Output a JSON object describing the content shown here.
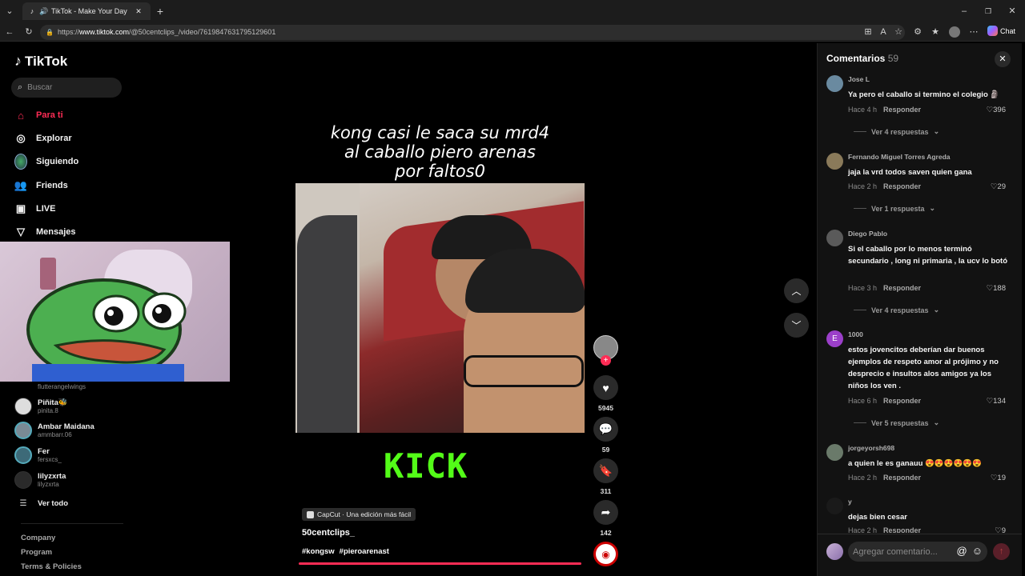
{
  "browser": {
    "tab_title": "TikTok - Make Your Day",
    "url_prefix": "https://",
    "url_host": "www.tiktok.com",
    "url_path": "/@50centclips_/video/7619847631795129601",
    "chat_label": "Chat"
  },
  "sidebar": {
    "logo": "TikTok",
    "search_placeholder": "Buscar",
    "nav": [
      {
        "label": "Para ti",
        "icon": "home-icon"
      },
      {
        "label": "Explorar",
        "icon": "compass-icon"
      },
      {
        "label": "Siguiendo",
        "icon": "following-avatar-icon"
      },
      {
        "label": "Friends",
        "icon": "friends-icon"
      },
      {
        "label": "LIVE",
        "icon": "live-icon"
      },
      {
        "label": "Mensajes",
        "icon": "send-icon"
      }
    ],
    "accounts": [
      {
        "name": "",
        "handle": "flutterangelwings"
      },
      {
        "name": "Piñita🐝",
        "handle": "pinita.8"
      },
      {
        "name": "Ambar Maidana",
        "handle": "ammbarr.06"
      },
      {
        "name": "Fer",
        "handle": "fersxcs_"
      },
      {
        "name": "lilyzxrta",
        "handle": "lilyzxrta"
      }
    ],
    "see_all": "Ver todo",
    "footer": [
      "Company",
      "Program",
      "Terms & Policies"
    ]
  },
  "video": {
    "caption_lines": [
      "kong casi le saca su mrd4",
      "al caballo piero arenas",
      "por faltos0"
    ],
    "overlay_text": "KICK",
    "capcut_label": "CapCut · Una edición más fácil",
    "author": "50centclips_",
    "tags": [
      "#kongsw",
      "#pieroarenast"
    ]
  },
  "actions": {
    "likes": "5945",
    "comments": "59",
    "saves": "311",
    "shares": "142"
  },
  "comments": {
    "title": "Comentarios",
    "count": "59",
    "reply_label": "Responder",
    "input_placeholder": "Agregar comentario...",
    "items": [
      {
        "user": "Jose L",
        "text": "Ya pero el caballo si termino el colegio 🗿",
        "time": "Hace 4 h",
        "likes": "396",
        "more": "Ver 4 respuestas"
      },
      {
        "user": "Fernando Miguel Torres Agreda",
        "text": "jaja la vrd todos saven quien gana",
        "time": "Hace 2 h",
        "likes": "29",
        "more": "Ver 1 respuesta"
      },
      {
        "user": "Diego Pablo",
        "text": "Si el caballo por lo menos terminó secundario , long ni primaria , la ucv lo botó",
        "time": "Hace 3 h",
        "likes": "188",
        "more": "Ver 4 respuestas"
      },
      {
        "user": "1000",
        "text": "estos jovencitos deberían dar buenos ejemplos de respeto amor al prójimo y no desprecio e insultos alos amigos ya los niños los ven .",
        "time": "Hace 6 h",
        "likes": "134",
        "more": "Ver 5 respuestas"
      },
      {
        "user": "jorgeyorsh698",
        "text": "a quien le es ganauu 😍😍😍😍😍😍",
        "time": "Hace 2 h",
        "likes": "19",
        "more": ""
      },
      {
        "user": "y",
        "text": "dejas bien cesar",
        "time": "Hace 2 h",
        "likes": "9",
        "more": ""
      }
    ]
  },
  "colors": {
    "accent": "#fe2c55",
    "kick_green": "#53fc18"
  }
}
